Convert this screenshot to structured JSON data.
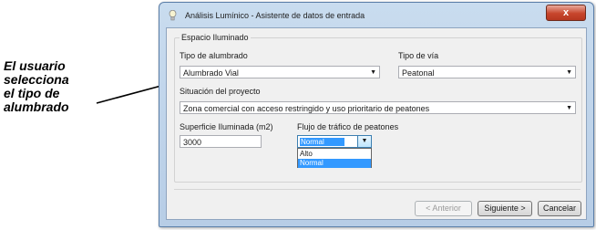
{
  "annotation": {
    "lines": [
      "El usuario",
      "selecciona",
      "el tipo de",
      "alumbrado"
    ]
  },
  "window": {
    "title": "Análisis Lumínico - Asistente de datos de entrada",
    "close_label": "x"
  },
  "group": {
    "title": "Espacio Iluminado",
    "tipo_alumbrado": {
      "label": "Tipo de alumbrado",
      "value": "Alumbrado Vial"
    },
    "tipo_via": {
      "label": "Tipo de vía",
      "value": "Peatonal"
    },
    "situacion": {
      "label": "Situación del proyecto",
      "value": "Zona comercial con acceso restringido y uso prioritario de peatones"
    },
    "superficie": {
      "label": "Superficie Iluminada (m2)",
      "value": "3000"
    },
    "flujo": {
      "label": "Flujo de tráfico de peatones",
      "value": "Normal",
      "options": [
        "Alto",
        "Normal"
      ],
      "selected_option": "Normal"
    }
  },
  "buttons": {
    "anterior": "< Anterior",
    "siguiente": "Siguiente >",
    "cancelar": "Cancelar"
  },
  "icons": {
    "title_icon": "lightbulb-icon",
    "dropdown_arrow": "chevron-down-icon"
  },
  "colors": {
    "selection": "#3399ff",
    "close_button": "#c7452c",
    "window_frame": "#b7cde6"
  }
}
